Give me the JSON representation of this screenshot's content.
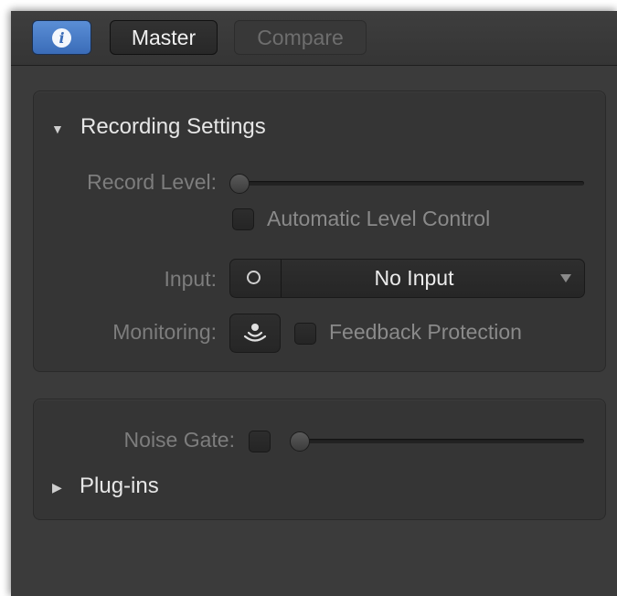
{
  "toolbar": {
    "info_icon": "info-icon",
    "master_label": "Master",
    "compare_label": "Compare",
    "info_color": "#4a7fcc"
  },
  "recording": {
    "title": "Recording Settings",
    "expanded": true,
    "record_level_label": "Record Level:",
    "record_level_value": 0,
    "auto_level_label": "Automatic Level Control",
    "auto_level_checked": false,
    "input_label": "Input:",
    "input_mode_icon": "circle-icon",
    "input_value": "No Input",
    "monitoring_label": "Monitoring:",
    "monitoring_icon": "monitoring-icon",
    "feedback_label": "Feedback Protection",
    "feedback_checked": false
  },
  "effects": {
    "noise_gate_label": "Noise Gate:",
    "noise_gate_checked": false,
    "noise_gate_value": 0,
    "plugins_label": "Plug-ins",
    "plugins_expanded": false
  }
}
